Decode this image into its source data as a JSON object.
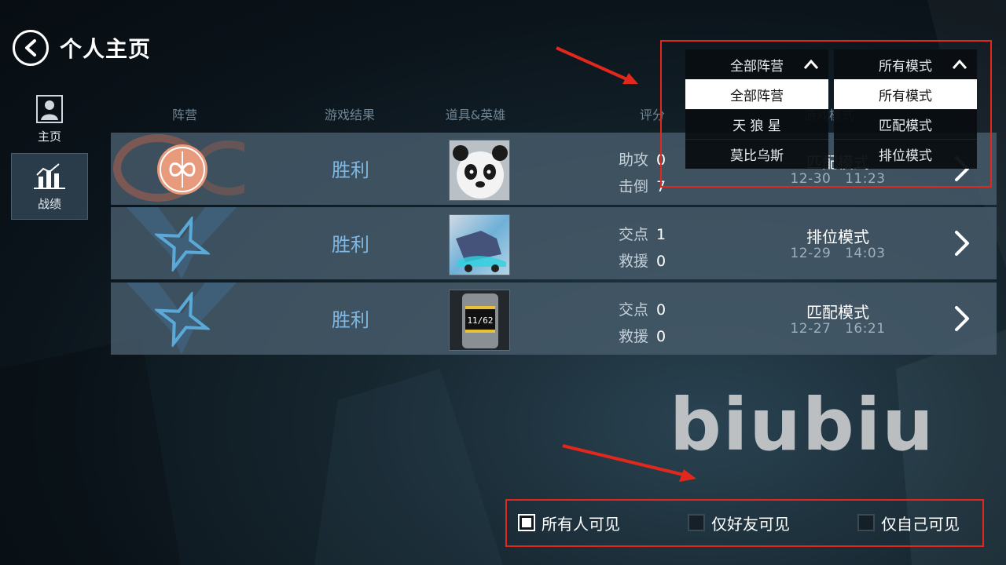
{
  "header": {
    "title": "个人主页",
    "back_icon": "chevron-left-icon"
  },
  "side_nav": [
    {
      "label": "主页",
      "icon": "profile-icon",
      "active": false
    },
    {
      "label": "战绩",
      "icon": "bar-chart-icon",
      "active": true
    }
  ],
  "table": {
    "columns": [
      "阵营",
      "游戏结果",
      "道具&英雄",
      "评分",
      "游戏模式"
    ],
    "rows": [
      {
        "faction_icon": "infinity-emblem-icon",
        "result": "胜利",
        "item_image": "panda-hero-portrait",
        "stats": [
          {
            "label": "助攻",
            "value": "0"
          },
          {
            "label": "击倒",
            "value": "7"
          }
        ],
        "mode": "匹配模式",
        "date": "12-30",
        "time": "11:23"
      },
      {
        "faction_icon": "star-emblem-icon",
        "result": "胜利",
        "item_image": "skate-item-image",
        "stats": [
          {
            "label": "交点",
            "value": "1"
          },
          {
            "label": "救援",
            "value": "0"
          }
        ],
        "mode": "排位模式",
        "date": "12-29",
        "time": "14:03"
      },
      {
        "faction_icon": "star-emblem-icon",
        "result": "胜利",
        "item_image": "watch-item-image",
        "item_text": "11/62",
        "stats": [
          {
            "label": "交点",
            "value": "0"
          },
          {
            "label": "救援",
            "value": "0"
          }
        ],
        "mode": "匹配模式",
        "date": "12-27",
        "time": "16:21"
      }
    ]
  },
  "faction_dropdown": {
    "selected": "全部阵营",
    "options": [
      "全部阵营",
      "天 狼 星",
      "莫比乌斯"
    ]
  },
  "mode_dropdown": {
    "selected": "所有模式",
    "options": [
      "所有模式",
      "匹配模式",
      "排位模式"
    ]
  },
  "watermark": "biubiu",
  "visibility": [
    {
      "label": "所有人可见",
      "checked": true
    },
    {
      "label": "仅好友可见",
      "checked": false
    },
    {
      "label": "仅自己可见",
      "checked": false
    }
  ],
  "colors": {
    "accent_result": "#7fb7e2",
    "annotation_red": "#e2281c",
    "emblem_orange": "#e79a7c",
    "emblem_blue": "#5aa9d6"
  }
}
